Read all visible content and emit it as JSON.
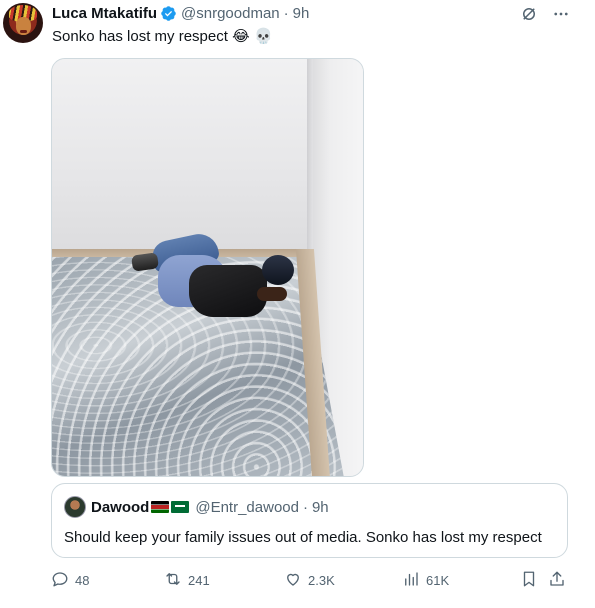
{
  "tweet": {
    "author_name": "Luca Mtakatifu",
    "handle": "@snrgoodman",
    "separator": "·",
    "time": "9h",
    "text": "Sonko has lost my respect",
    "emojis": "😂 💀"
  },
  "quote": {
    "author_name": "Dawood",
    "handle": "@Entr_dawood",
    "separator": "·",
    "time": "9h",
    "text": "Should keep your family issues out of media. Sonko has lost my respect"
  },
  "actions": {
    "replies": "48",
    "reposts": "241",
    "likes": "2.3K",
    "views": "61K"
  },
  "colors": {
    "verified": "#1d9bf0",
    "muted_text": "#536471",
    "text": "#0f1419",
    "border": "#cfd9de"
  },
  "icons": [
    "verified-badge-icon",
    "grok-icon",
    "more-icon",
    "reply-icon",
    "repost-icon",
    "like-icon",
    "views-icon",
    "bookmark-icon",
    "share-icon"
  ]
}
